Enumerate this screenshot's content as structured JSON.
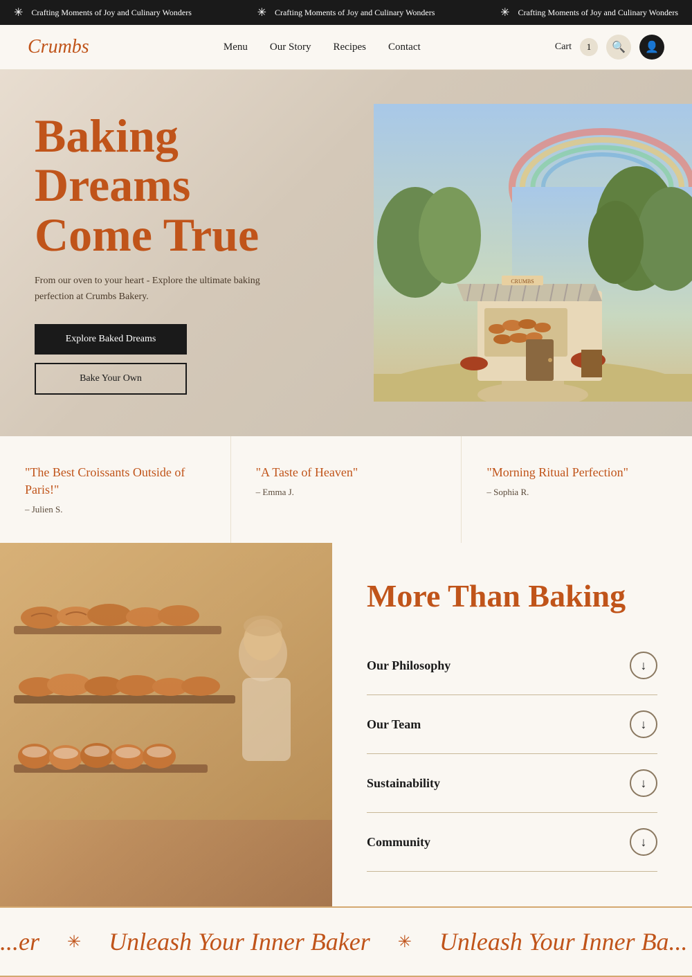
{
  "top_banner": {
    "text": "Crafting Moments of Joy and Culinary Wonders",
    "items": [
      "Crafting Moments of Joy and Culinary Wonders",
      "Crafting Moments of Joy and Culinary Wonders",
      "Crafting Moments of Joy and Culinary Wonders"
    ]
  },
  "header": {
    "logo": "Crumbs",
    "nav": [
      {
        "label": "Menu",
        "href": "#"
      },
      {
        "label": "Our Story",
        "href": "#"
      },
      {
        "label": "Recipes",
        "href": "#"
      },
      {
        "label": "Contact",
        "href": "#"
      }
    ],
    "cart_label": "Cart",
    "cart_count": "1",
    "search_icon": "🔍",
    "user_icon": "👤"
  },
  "hero": {
    "title_line1": "Baking",
    "title_line2": "Dreams",
    "title_line3": "Come True",
    "subtitle": "From our oven to your heart - Explore the ultimate baking perfection at Crumbs Bakery.",
    "btn_primary": "Explore Baked Dreams",
    "btn_secondary": "Bake Your Own"
  },
  "testimonials": [
    {
      "quote": "\"The Best Croissants Outside of Paris!\"",
      "author": "– Julien S."
    },
    {
      "quote": "\"A Taste of Heaven\"",
      "author": "– Emma J."
    },
    {
      "quote": "\"Morning Ritual Perfection\"",
      "author": "– Sophia R."
    }
  ],
  "more_section": {
    "title": "More Than Baking",
    "accordion": [
      {
        "label": "Our Philosophy"
      },
      {
        "label": "Our Team"
      },
      {
        "label": "Sustainability"
      },
      {
        "label": "Community"
      }
    ]
  },
  "bottom_banner": {
    "text": "Unleash Your Inner Baker",
    "star_icon": "✳"
  }
}
